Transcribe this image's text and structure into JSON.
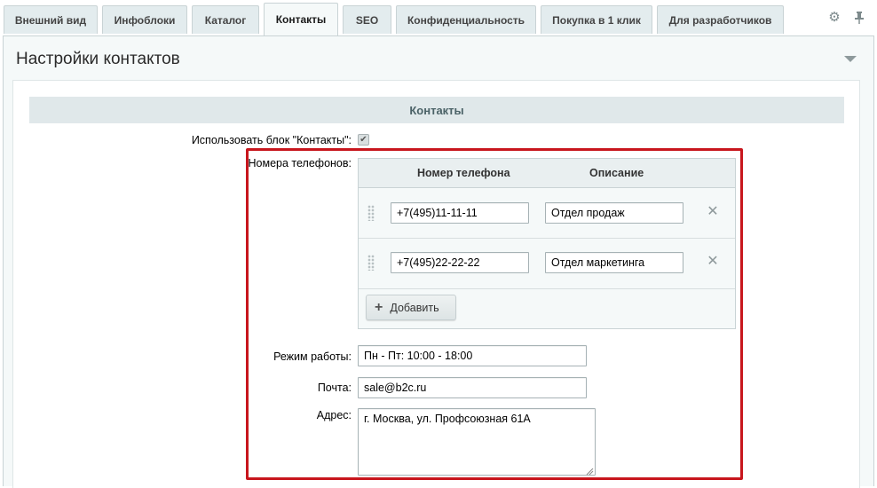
{
  "tabs": [
    {
      "label": "Внешний вид"
    },
    {
      "label": "Инфоблоки"
    },
    {
      "label": "Каталог"
    },
    {
      "label": "Контакты",
      "active": true
    },
    {
      "label": "SEO"
    },
    {
      "label": "Конфиденциальность"
    },
    {
      "label": "Покупка в 1 клик"
    },
    {
      "label": "Для разработчиков"
    }
  ],
  "toolbar": {
    "settings_icon": "gear-icon",
    "pin_icon": "pin-icon"
  },
  "panel": {
    "title": "Настройки контактов"
  },
  "section": {
    "title": "Контакты"
  },
  "use_block": {
    "label": "Использовать блок \"Контакты\":",
    "checked": true
  },
  "phones": {
    "label": "Номера телефонов:",
    "columns": {
      "number": "Номер телефона",
      "description": "Описание"
    },
    "rows": [
      {
        "number": "+7(495)11-11-11",
        "description": "Отдел продаж"
      },
      {
        "number": "+7(495)22-22-22",
        "description": "Отдел маркетинга"
      }
    ],
    "add_label": "Добавить"
  },
  "work_mode": {
    "label": "Режим работы:",
    "value": "Пн - Пт: 10:00 - 18:00"
  },
  "email": {
    "label": "Почта:",
    "value": "sale@b2c.ru"
  },
  "address": {
    "label": "Адрес:",
    "value": "г. Москва, ул. Профсоюзная 61А"
  },
  "colors": {
    "highlight": "#c8161d",
    "section_bg": "#e0e8ea",
    "tab_bg": "#e3ecee"
  }
}
